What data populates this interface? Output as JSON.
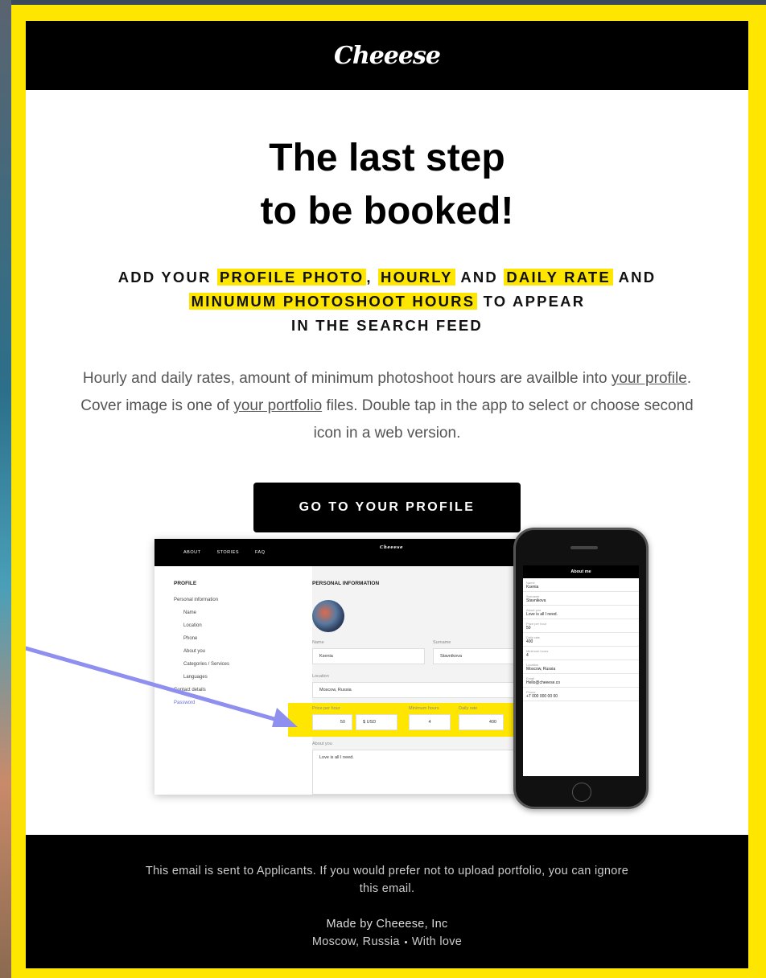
{
  "brand": {
    "logo_text": "Cheeese",
    "accent": "#ffe600"
  },
  "headline": {
    "line1": "The last step",
    "line2": "to be booked!"
  },
  "subheadline": {
    "p1": "ADD YOUR",
    "h1": "PROFILE PHOTO",
    "p2": ",",
    "h2": "HOURLY",
    "p3": "AND",
    "h3": "DAILY RATE",
    "p4": "AND",
    "h4": "MINUMUM PHOTOSHOOT HOURS",
    "p5": "TO APPEAR",
    "p6": "IN THE SEARCH FEED"
  },
  "description": {
    "t1": "Hourly and daily rates, amount of minimum photoshoot hours are availble into ",
    "link1": "your profile",
    "t2": ". Cover image is one of ",
    "link2": "your portfolio",
    "t3": " files. Double tap in the app to select or choose second icon in a web version."
  },
  "cta": {
    "label": "GO TO YOUR PROFILE"
  },
  "illustration": {
    "nav": [
      "ABOUT",
      "STORIES",
      "FAQ"
    ],
    "logo": "Cheeese",
    "sidebar_title": "PROFILE",
    "sidebar": [
      "Personal information",
      "Name",
      "Location",
      "Phone",
      "About you",
      "Categories / Services",
      "Languages",
      "Contact details",
      "Password"
    ],
    "section_title": "PERSONAL INFORMATION",
    "name_label": "Name",
    "name_value": "Ksenia",
    "surname_label": "Surname",
    "surname_value": "Stavnikova",
    "location_label": "Location",
    "location_value": "Moscow, Russia",
    "price_label": "Price per hour",
    "price_value": "50",
    "currency": "$ USD",
    "min_hours_label": "Minimum hours",
    "min_hours_value": "4",
    "daily_label": "Daily rate",
    "daily_value": "400",
    "about_label": "About you",
    "about_value": "Love is all I need.",
    "phone_title": "About me",
    "phone_fields": [
      {
        "label": "Name",
        "value": "Ksenia"
      },
      {
        "label": "Surname",
        "value": "Stavnikova"
      },
      {
        "label": "About you",
        "value": "Love is all I need."
      },
      {
        "label": "Price per hour",
        "value": "50"
      },
      {
        "label": "Daily rate",
        "value": "400"
      },
      {
        "label": "Minimum hours",
        "value": "4"
      },
      {
        "label": "Location",
        "value": "Moscow, Russia"
      },
      {
        "label": "Email",
        "value": "Hello@cheeese.co"
      },
      {
        "label": "Phone",
        "value": "+7 000 000 00 00"
      }
    ]
  },
  "footer": {
    "notice": "This email is sent to Applicants. If you would prefer not to upload portfolio, you can ignore this email.",
    "made_by": "Made by Cheeese, Inc",
    "location": "Moscow, Russia",
    "love": "With love"
  }
}
